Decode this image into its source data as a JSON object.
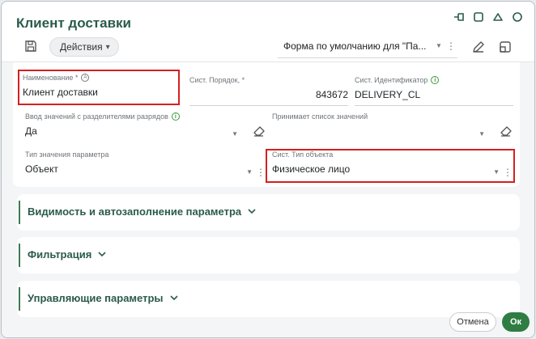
{
  "dialog": {
    "title": "Клиент доставки",
    "icons": [
      "pin-icon",
      "maximize-icon",
      "collapse-icon",
      "close-icon"
    ]
  },
  "toolbar": {
    "actions_label": "Действия",
    "actions_caret": "▾",
    "form_select_value": "Форма по умолчанию для \"Па...",
    "caret": "▼",
    "kebab": "⋮"
  },
  "fields": {
    "name": {
      "label": "Наименование *",
      "value": "Клиент доставки"
    },
    "sys_order": {
      "label": "Сист. Порядок, *",
      "value": "843672"
    },
    "sys_id": {
      "label": "Сист. Идентификатор",
      "value": "DELIVERY_CL"
    },
    "input_sep": {
      "label": "Ввод значений с разделителями разрядов",
      "value": "Да"
    },
    "accepts_list": {
      "label": "Принимает список значений",
      "value": ""
    },
    "param_type": {
      "label": "Тип значения параметра",
      "value": "Объект"
    },
    "obj_type": {
      "label": "Сист. Тип объекта",
      "value": "Физическое лицо"
    }
  },
  "sections": [
    {
      "title": "Видимость и автозаполнение параметра"
    },
    {
      "title": "Фильтрация"
    },
    {
      "title": "Управляющие параметры"
    }
  ],
  "footer": {
    "cancel_label": "Отмена",
    "ok_label": "Ок"
  },
  "colors": {
    "accent": "#2a5b4a",
    "ok_button": "#2f7d43",
    "highlight": "#d42020",
    "info": "#3a9b3a"
  }
}
